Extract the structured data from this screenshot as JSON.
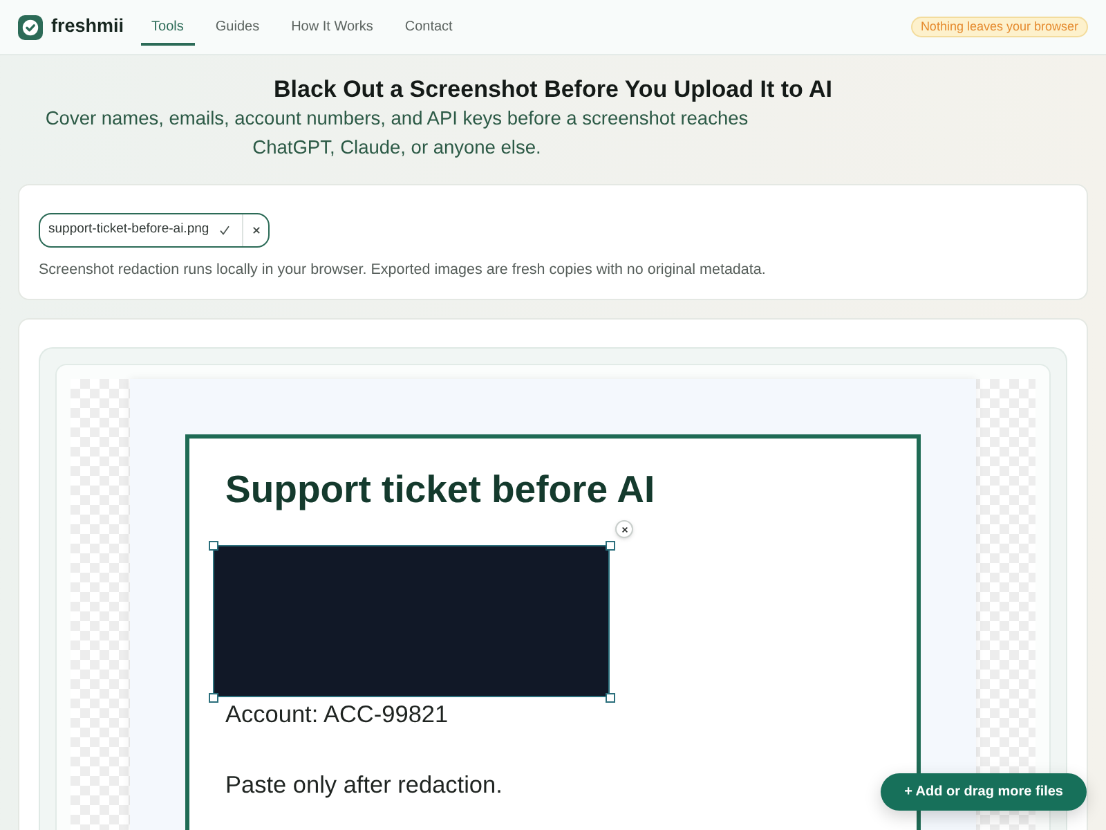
{
  "header": {
    "brand": "freshmii",
    "nav": [
      {
        "label": "Tools",
        "selected": true
      },
      {
        "label": "Guides",
        "selected": false
      },
      {
        "label": "How It Works",
        "selected": false
      },
      {
        "label": "Contact",
        "selected": false
      }
    ],
    "badge": "Nothing leaves your browser"
  },
  "hero": {
    "title": "Black Out a Screenshot Before You Upload It to AI",
    "subtitle": "Cover names, emails, account numbers, and API keys before a screenshot reaches ChatGPT, Claude, or anyone else."
  },
  "upload": {
    "files": [
      {
        "name": "support-ticket-before-ai.png",
        "uploaded": true
      }
    ],
    "note": "Screenshot redaction runs locally in your browser. Exported images are fresh copies with no original metadata."
  },
  "editor": {
    "document": {
      "heading": "Support ticket before AI",
      "lines": [
        "Account: ACC-99821",
        "Paste only after redaction."
      ]
    },
    "redactions": [
      {
        "selected": true
      }
    ]
  },
  "add_files_button": "+ Add or drag more files"
}
